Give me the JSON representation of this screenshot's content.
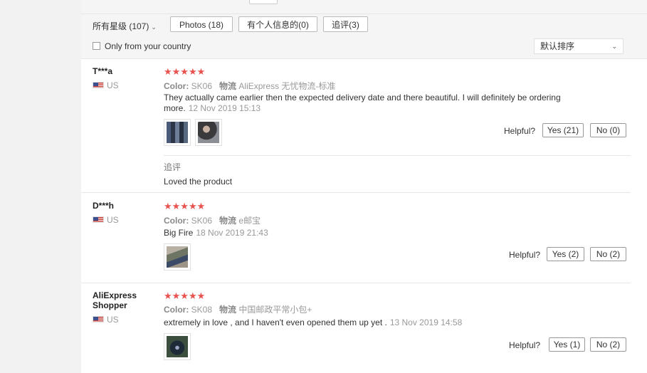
{
  "filters": {
    "rating_label": "所有星级 (107)",
    "photos_label": "Photos (18)",
    "personal_label": "有个人信息的(0)",
    "additional_label": "追评(3)",
    "only_country_label": "Only from your country",
    "sort_label": "默认排序"
  },
  "reviews": [
    {
      "name": "T***a",
      "country": "US",
      "stars": "★★★★★",
      "color_label": "Color:",
      "color_value": "SK06",
      "shipping_label": "物流",
      "shipping_value": "AliExpress 无忧物流-标准",
      "text": "They actually came earlier then the expected delivery date and there beautiful. I will definitely be ordering more.",
      "date": "12 Nov 2019 15:13",
      "helpful_label": "Helpful?",
      "yes": "Yes (21)",
      "no": "No (0)",
      "additional_label": "追评",
      "additional_text": "Loved the product"
    },
    {
      "name": "D***h",
      "country": "US",
      "stars": "★★★★★",
      "color_label": "Color:",
      "color_value": "SK06",
      "shipping_label": "物流",
      "shipping_value": "e邮宝",
      "text": "Big Fire",
      "date": "18 Nov 2019 21:43",
      "helpful_label": "Helpful?",
      "yes": "Yes (2)",
      "no": "No (2)"
    },
    {
      "name": "AliExpress Shopper",
      "country": "US",
      "stars": "★★★★★",
      "color_label": "Color:",
      "color_value": "SK08",
      "shipping_label": "物流",
      "shipping_value": "中国邮政平常小包+",
      "text": "extremely in love , and I haven't even opened them up yet .",
      "date": "13 Nov 2019 14:58",
      "helpful_label": "Helpful?",
      "yes": "Yes (1)",
      "no": "No (2)"
    }
  ],
  "colors": {
    "star": "#e9534f",
    "muted": "#999999",
    "background": "#f2f2f2"
  }
}
